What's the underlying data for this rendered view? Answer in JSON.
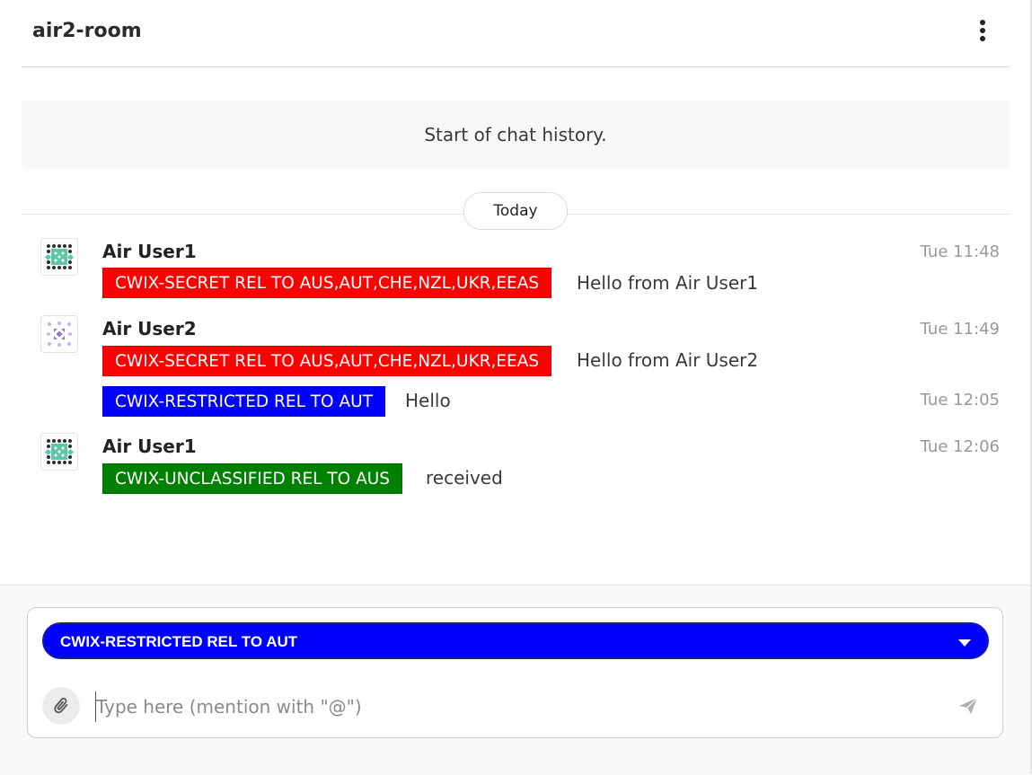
{
  "header": {
    "room_title": "air2-room",
    "menu_icon": "more-vertical-icon"
  },
  "history": {
    "banner_text": "Start of chat history."
  },
  "day_divider": {
    "label": "Today"
  },
  "classification_colors": {
    "secret": "#ff0000",
    "restricted": "#0000ff",
    "unclassified": "#008000"
  },
  "messages": [
    {
      "sender": "Air User1",
      "time": "Tue 11:48",
      "classification": "CWIX-SECRET REL TO AUS,AUT,CHE,NZL,UKR,EEAS",
      "text": "Hello from Air User1"
    },
    {
      "sender": "Air User2",
      "time": "Tue 11:49",
      "classification": "CWIX-SECRET REL TO AUS,AUT,CHE,NZL,UKR,EEAS",
      "text": "Hello from Air User2"
    },
    {
      "sender": "",
      "time": "Tue 12:05",
      "classification": "CWIX-RESTRICTED REL TO AUT",
      "text": "Hello"
    },
    {
      "sender": "Air User1",
      "time": "Tue 12:06",
      "classification": "CWIX-UNCLASSIFIED REL TO AUS",
      "text": "received"
    }
  ],
  "composer": {
    "classification_selected": "CWIX-RESTRICTED REL TO AUT",
    "classification_color": "#0000ff",
    "placeholder": "Type here (mention with \"@\")",
    "value": "",
    "attach_icon": "paperclip-icon",
    "send_icon": "send-icon"
  }
}
